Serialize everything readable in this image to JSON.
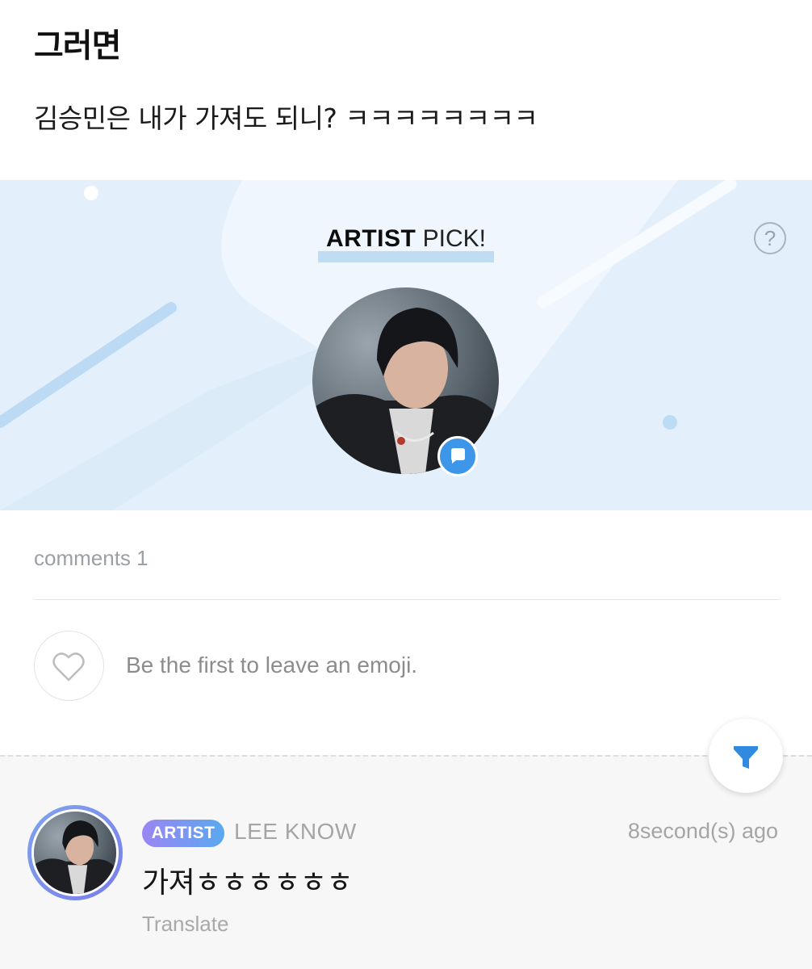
{
  "post": {
    "title": "그러면",
    "body": "김승민은 내가 가져도 되니? ㅋㅋㅋㅋㅋㅋㅋㅋ"
  },
  "artist_pick": {
    "title_strong": "ARTIST",
    "title_light": "PICK!",
    "help_label": "?",
    "avatar_icon": "artist-photo",
    "badge_icon": "chat-bubble-icon",
    "background_color": "#e3f0fb"
  },
  "comments": {
    "count_label": "comments 1",
    "emoji_prompt": "Be the first to leave an emoji.",
    "emoji_icon": "heart-outline-icon",
    "filter_icon": "filter-funnel-icon",
    "items": [
      {
        "badge": "ARTIST",
        "author": "LEE KNOW",
        "time": "8second(s) ago",
        "text": "가져ㅎㅎㅎㅎㅎㅎ",
        "translate_label": "Translate"
      }
    ]
  },
  "colors": {
    "accent": "#3e96e8",
    "badge_gradient_start": "#9a86f3",
    "badge_gradient_end": "#5aa8ef"
  }
}
